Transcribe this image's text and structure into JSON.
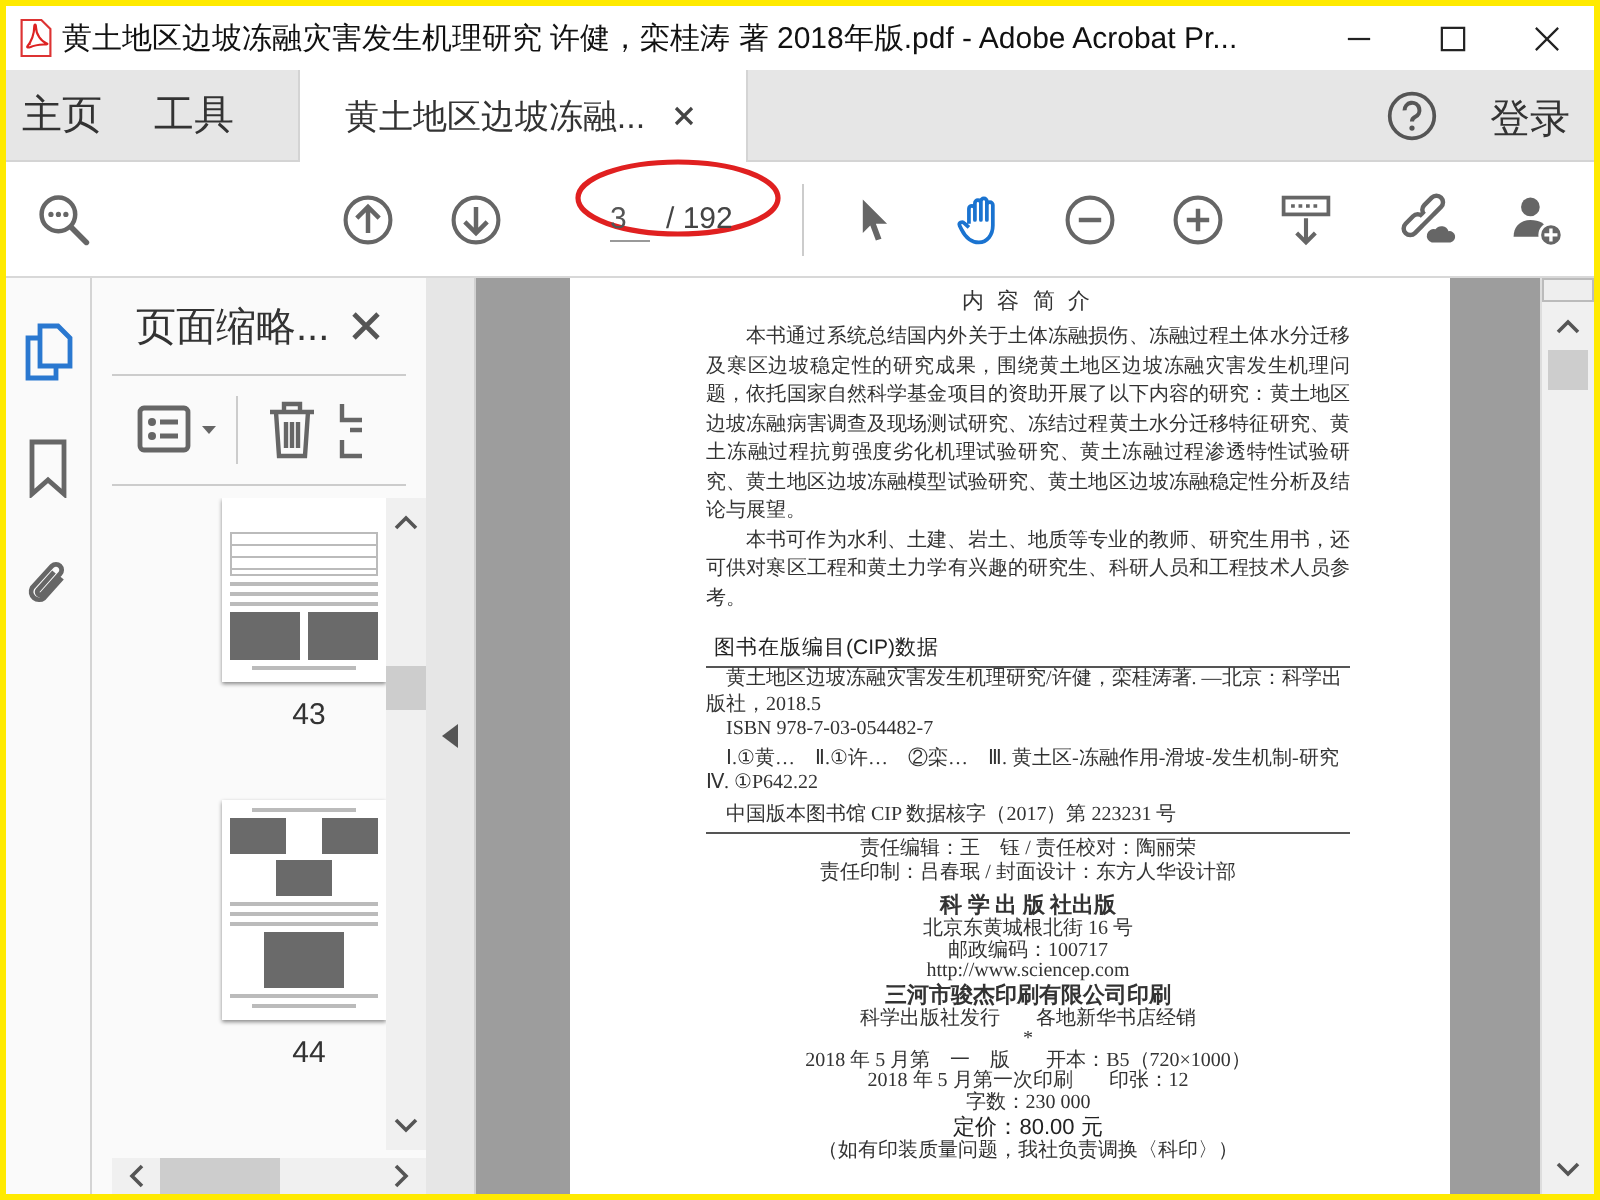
{
  "window": {
    "title": "黄土地区边坡冻融灾害发生机理研究 许健，栾桂涛 著 2018年版.pdf - Adobe Acrobat Pr..."
  },
  "tabs": [
    {
      "label": "主页",
      "selected": false,
      "closable": false
    },
    {
      "label": "工具",
      "selected": false,
      "closable": false
    },
    {
      "label": "黄土地区边坡冻融...",
      "selected": true,
      "closable": true
    }
  ],
  "account": {
    "label": "登录"
  },
  "toolbar": {
    "left_tools": [
      {
        "kind": "find",
        "selected": false
      }
    ],
    "nav_tools": [
      {
        "kind": "prev",
        "selected": false
      },
      {
        "kind": "next",
        "selected": false
      }
    ],
    "page": {
      "value": "3",
      "total": "/ 192"
    },
    "view_tools": [
      {
        "kind": "select",
        "selected": false
      },
      {
        "kind": "hand",
        "selected": true
      },
      {
        "kind": "zoom-out",
        "selected": false
      },
      {
        "kind": "zoom-in",
        "selected": false
      },
      {
        "kind": "scroll-mode",
        "selected": false
      }
    ],
    "right_tools": [
      {
        "kind": "share-link",
        "selected": false
      },
      {
        "kind": "add-user",
        "selected": false
      }
    ]
  },
  "sidebar": {
    "items": [
      {
        "kind": "pages",
        "selected": true
      },
      {
        "kind": "bookmarks",
        "selected": false
      },
      {
        "kind": "attachments",
        "selected": false
      }
    ]
  },
  "panel": {
    "title": "页面缩略...",
    "thumbnails": [
      {
        "kind": "table-photos",
        "label": "43"
      },
      {
        "kind": "photos",
        "label": "44"
      }
    ]
  },
  "document": {
    "heading": "内 容 简 介",
    "paragraphs": [
      "本书通过系统总结国内外关于土体冻融损伤、冻融过程土体水分迁移及寒区边坡稳定性的研究成果，围绕黄土地区边坡冻融灾害发生机理问题，依托国家自然科学基金项目的资助开展了以下内容的研究：黄土地区边坡冻融病害调查及现场测试研究、冻结过程黄土水分迁移特征研究、黄土冻融过程抗剪强度劣化机理试验研究、黄土冻融过程渗透特性试验研究、黄土地区边坡冻融模型试验研究、黄土地区边坡冻融稳定性分析及结论与展望。",
      "本书可作为水利、土建、岩土、地质等专业的教师、研究生用书，还可供对寒区工程和黄土力学有兴趣的研究生、科研人员和工程技术人员参考。"
    ],
    "cip": {
      "heading": "图书在版编目(CIP)数据",
      "lines": [
        "黄土地区边坡冻融灾害发生机理研究/许健，栾桂涛著. —北京：科学出版社，2018.5",
        "ISBN 978-7-03-054482-7",
        "Ⅰ.①黄…　Ⅱ.①许…　②栾…　Ⅲ. 黄土区-冻融作用-滑坡-发生机制-研究　Ⅳ. ①P642.22"
      ],
      "record": "中国版本图书馆 CIP 数据核字（2017）第 223231 号"
    },
    "credits": [
      "责任编辑：王　钰 / 责任校对：陶丽荣",
      "责任印制：吕春珉 / 封面设计：东方人华设计部"
    ],
    "imprint": [
      {
        "kind": "publisher",
        "text": "科 学 出 版 社出版"
      },
      {
        "kind": "small",
        "text": "北京东黄城根北街 16 号"
      },
      {
        "kind": "small",
        "text": "邮政编码：100717"
      },
      {
        "kind": "small",
        "text": "http://www.sciencep.com"
      },
      {
        "kind": "publisher",
        "text": "三河市骏杰印刷有限公司印刷"
      },
      {
        "kind": "pair",
        "left": "科学出版社发行",
        "right": "各地新华书店经销"
      },
      {
        "kind": "line",
        "text": "*"
      },
      {
        "kind": "pair",
        "left": "2018 年 5 月第　一　版",
        "right": "开本：B5（720×1000）"
      },
      {
        "kind": "pair",
        "left": "2018 年 5 月第一次印刷",
        "right": "印张：12"
      },
      {
        "kind": "line",
        "text": "字数：230 000"
      },
      {
        "kind": "price",
        "text": "定价：80.00 元"
      },
      {
        "kind": "line",
        "text": "（如有印装质量问题，我社负责调换〈科印〉）"
      }
    ]
  }
}
